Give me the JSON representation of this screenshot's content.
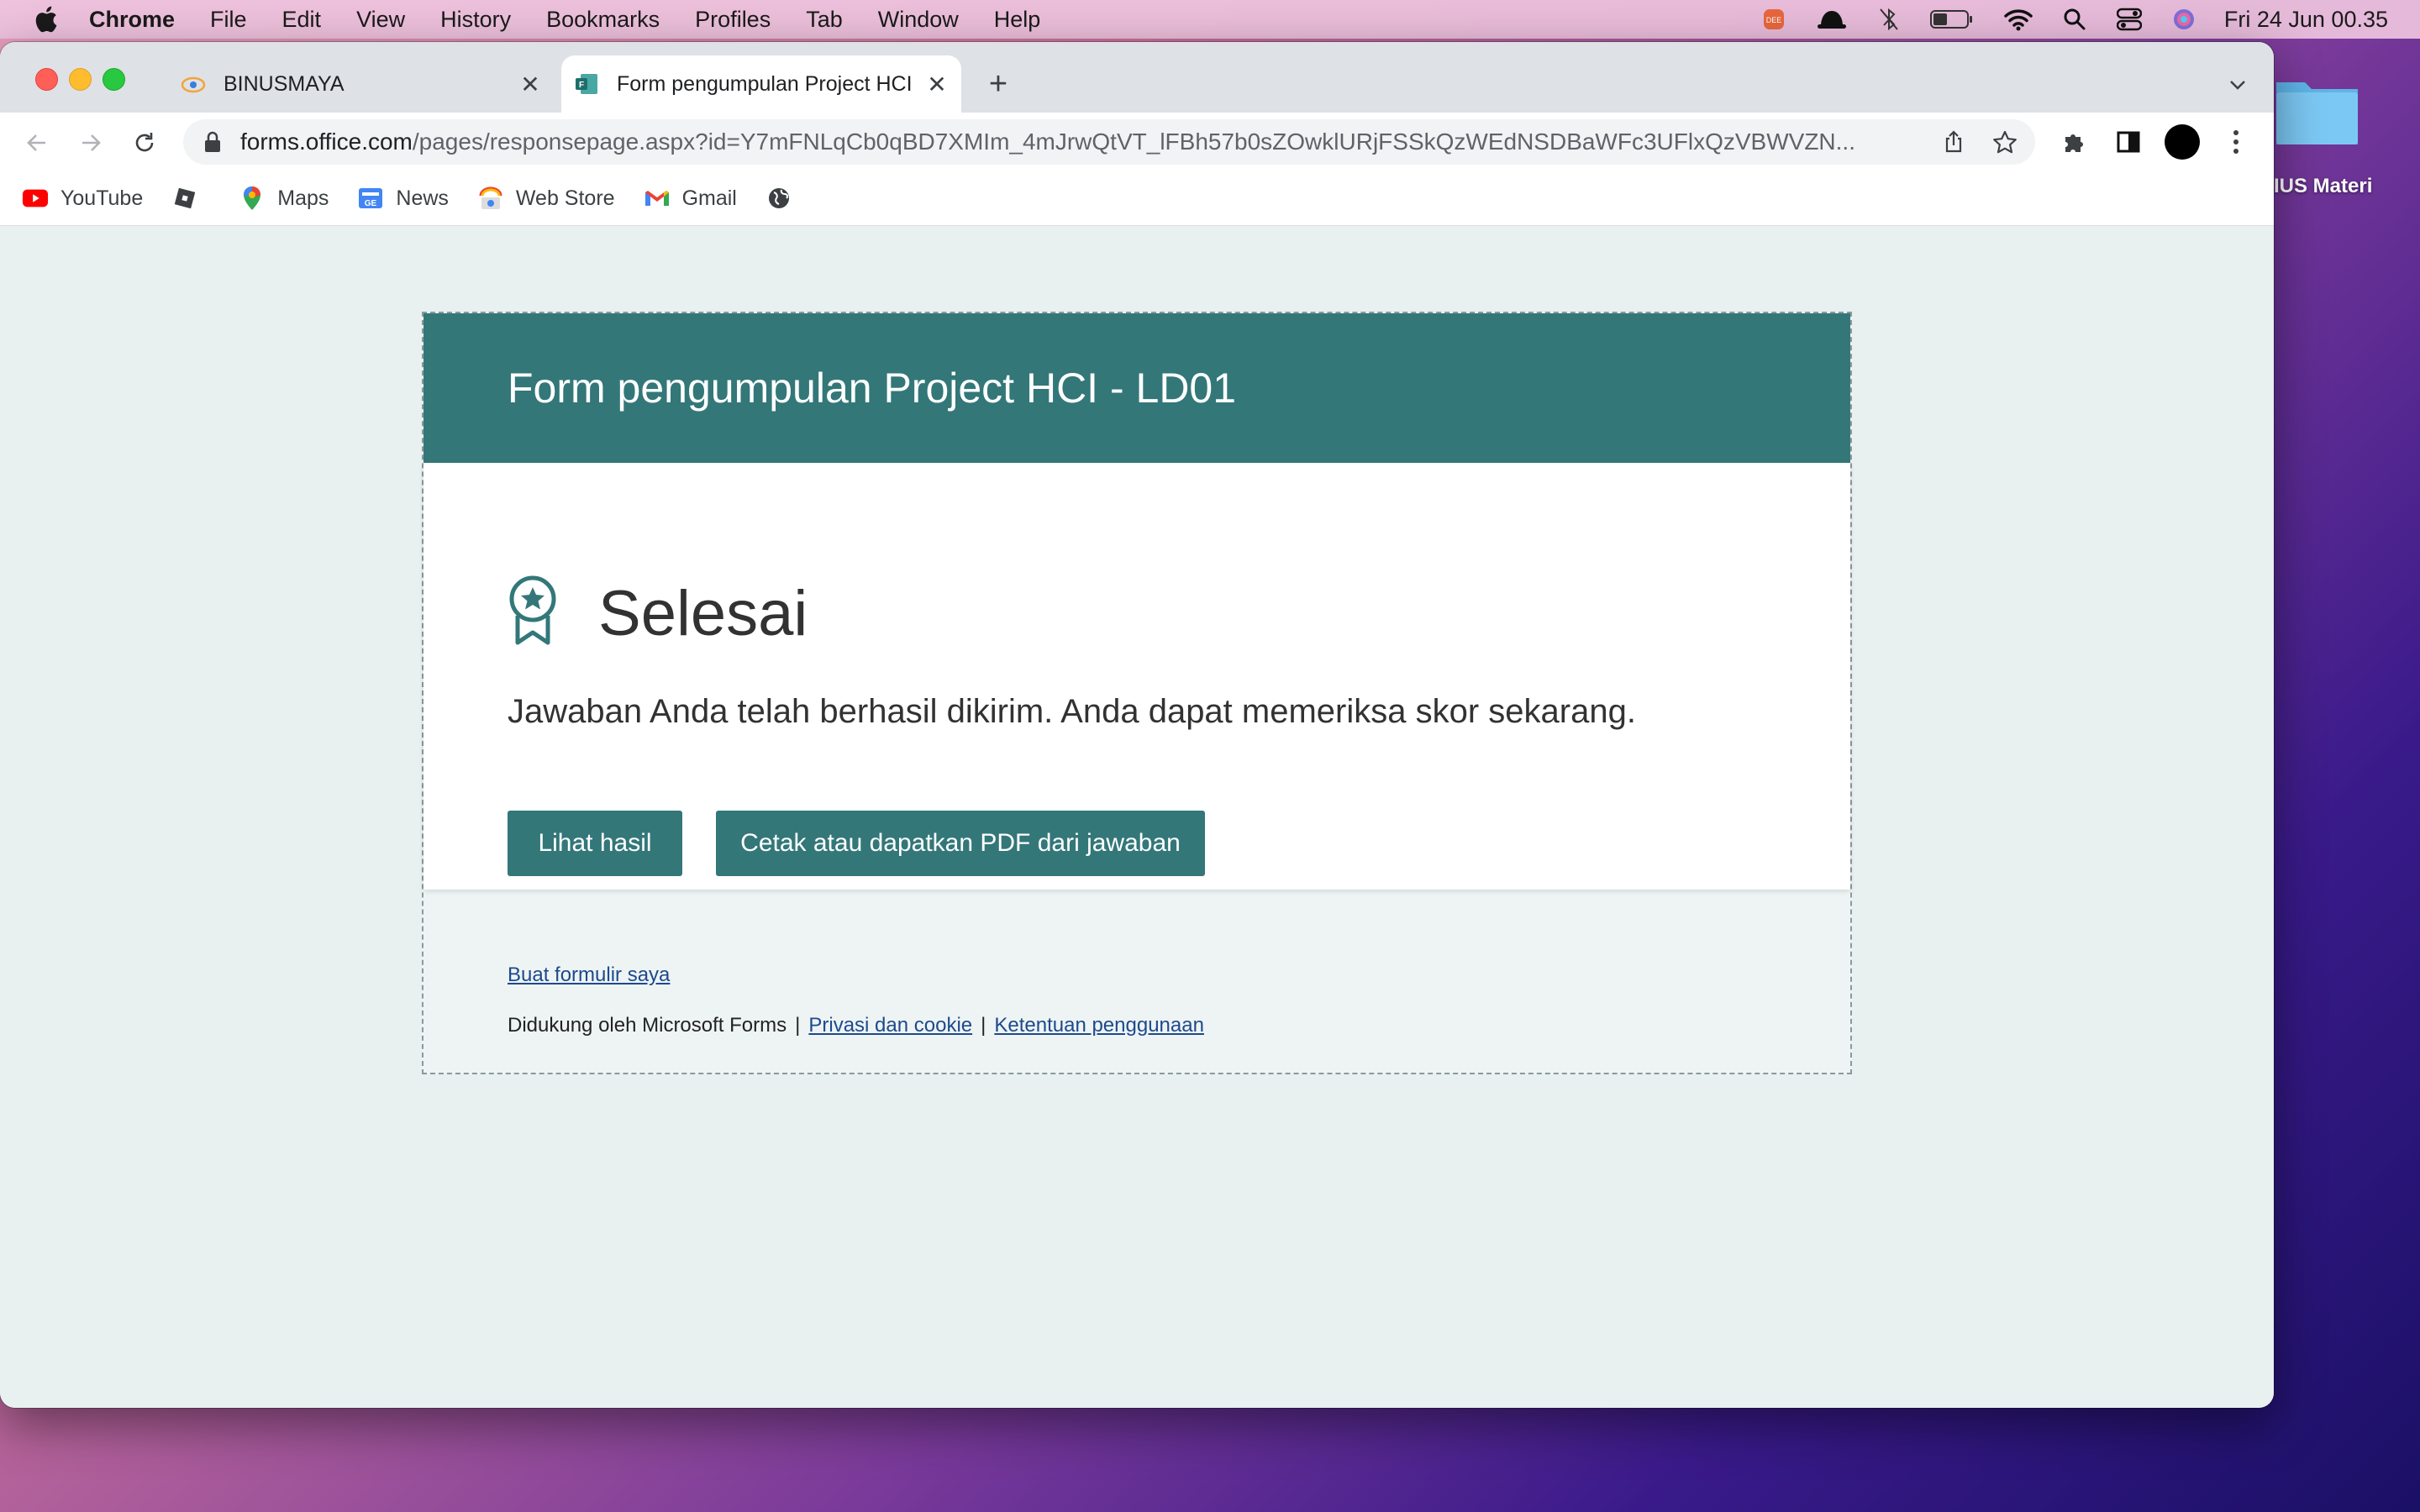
{
  "menubar": {
    "app": "Chrome",
    "items": [
      "File",
      "Edit",
      "View",
      "History",
      "Bookmarks",
      "Profiles",
      "Tab",
      "Window",
      "Help"
    ],
    "clock": "Fri 24 Jun  00.35"
  },
  "desktop": {
    "folder_label": "IUS Materi"
  },
  "tabs": [
    {
      "title": "BINUSMAYA",
      "active": false
    },
    {
      "title": "Form pengumpulan Project HCI",
      "active": true
    }
  ],
  "address_bar": {
    "host": "forms.office.com",
    "path": "/pages/responsepage.aspx?id=Y7mFNLqCb0qBD7XMIm_4mJrwQtVT_lFBh57b0sZOwklURjFSSkQzWEdNSDBaWFc3UFlxQzVBWVZN..."
  },
  "bookmarks": [
    {
      "label": "YouTube",
      "icon": "youtube-icon"
    },
    {
      "label": "",
      "icon": "roblox-icon"
    },
    {
      "label": "Maps",
      "icon": "maps-icon"
    },
    {
      "label": "News",
      "icon": "news-icon"
    },
    {
      "label": "Web Store",
      "icon": "webstore-icon"
    },
    {
      "label": "Gmail",
      "icon": "gmail-icon"
    },
    {
      "label": "",
      "icon": "globe-icon"
    }
  ],
  "form": {
    "header_title": "Form pengumpulan Project HCI - LD01",
    "done_title": "Selesai",
    "done_message": "Jawaban Anda telah berhasil dikirim. Anda dapat memeriksa skor sekarang.",
    "view_results_button": "Lihat hasil",
    "print_pdf_button": "Cetak atau dapatkan PDF dari jawaban",
    "create_form_link": "Buat formulir saya",
    "powered_by": "Didukung oleh Microsoft Forms",
    "privacy_link": "Privasi dan cookie",
    "terms_link": "Ketentuan penggunaan",
    "separator": "|"
  },
  "colors": {
    "accent": "#337779",
    "page_bg": "#e8f0f0",
    "link": "#1d4a8c"
  }
}
